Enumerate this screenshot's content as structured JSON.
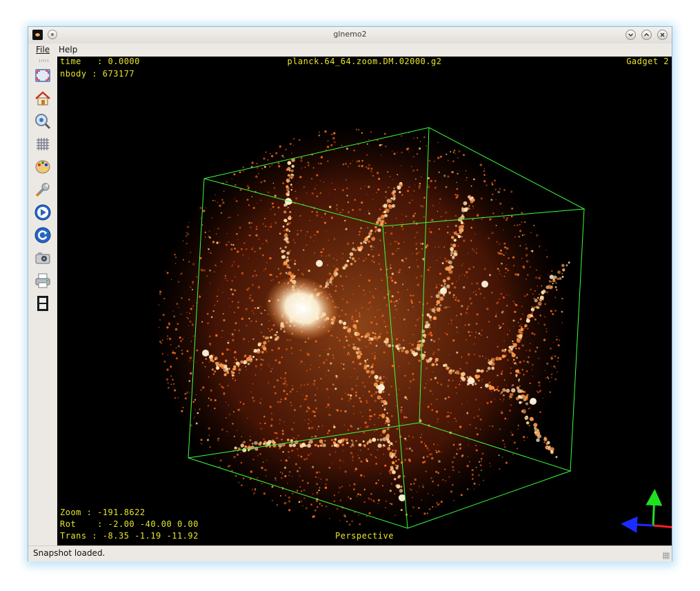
{
  "window": {
    "title": "glnemo2"
  },
  "menu": {
    "file": "File",
    "help": "Help"
  },
  "toolbar": {
    "icons": [
      "fullscreen-icon",
      "home-icon",
      "zoom-fit-icon",
      "grid-icon",
      "palette-icon",
      "wrench-icon",
      "play-icon",
      "reload-icon",
      "camera-icon",
      "printer-icon",
      "film-icon"
    ]
  },
  "viewport": {
    "time_label": "time   : 0.0000",
    "nbody_label": "nbody : 673177",
    "file_name": "planck.64_64.zoom.DM.02000.g2",
    "format": "Gadget 2",
    "zoom_label": "Zoom : -191.8622",
    "rot_label": "Rot    : -2.00 -40.00 0.00",
    "trans_label": "Trans : -8.35 -1.19 -11.92",
    "projection": "Perspective",
    "colors": {
      "hud_text": "#e6e62e",
      "box": "#3cff3c",
      "particles": "#ff6a1a",
      "axis_x": "#ff2020",
      "axis_y": "#20e020",
      "axis_z": "#1a2cff"
    }
  },
  "status": {
    "message": "Snapshot loaded."
  }
}
